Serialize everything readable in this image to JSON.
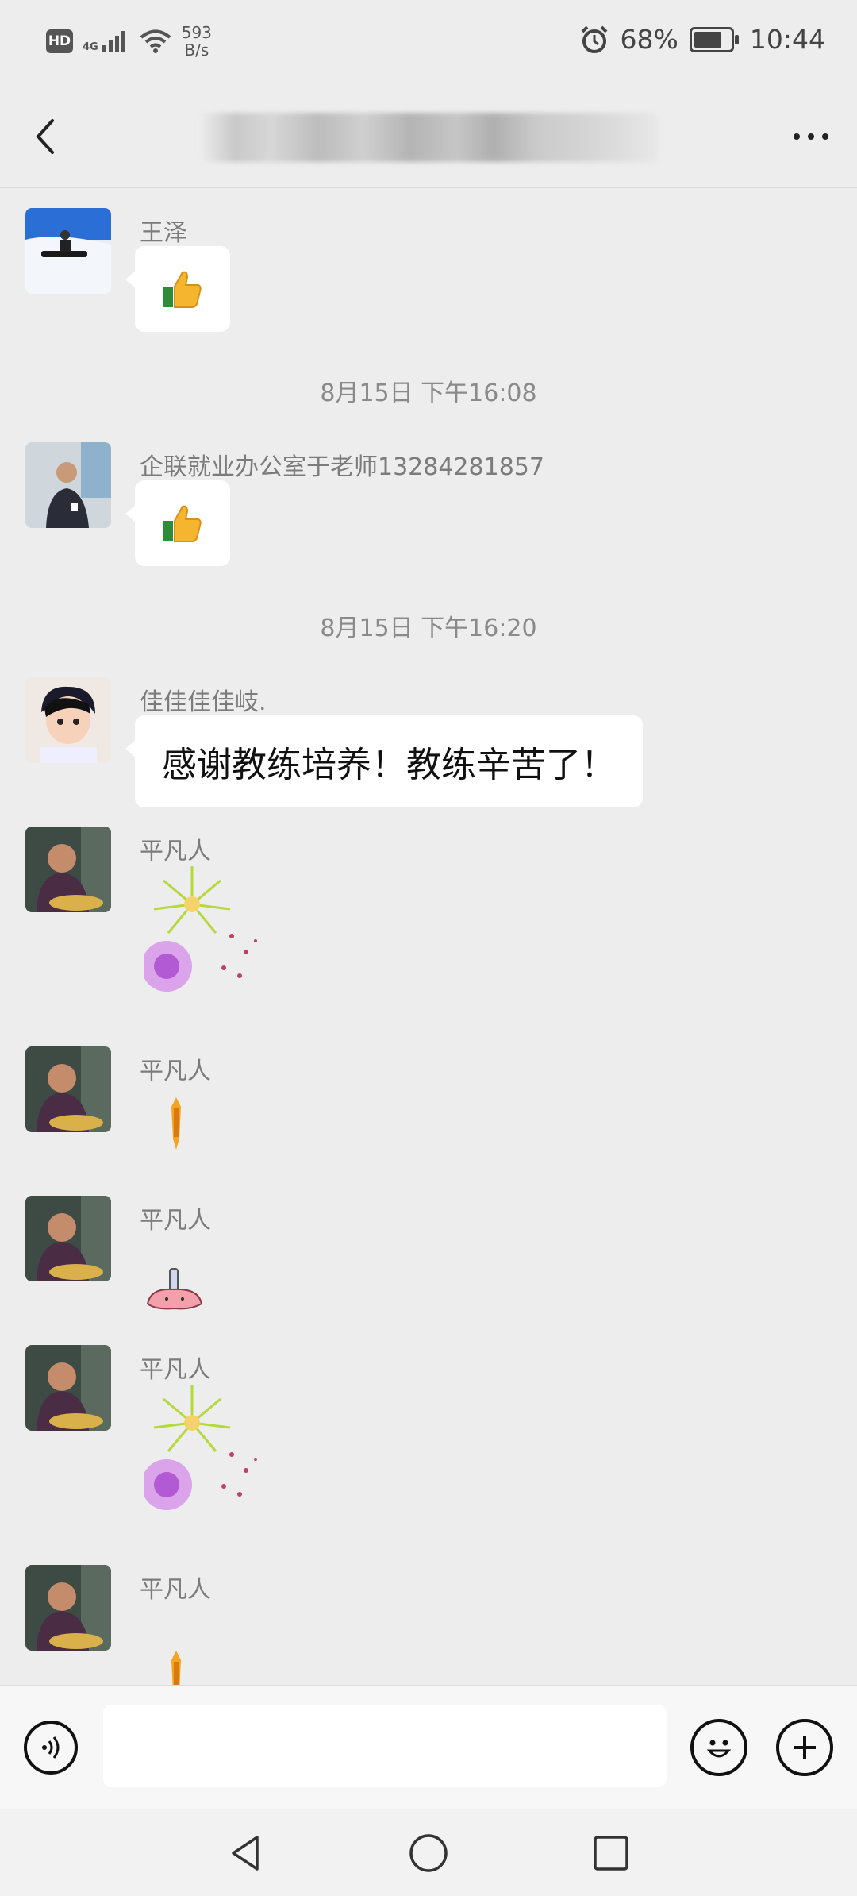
{
  "status_bar": {
    "hd": "HD",
    "network": "4G",
    "net_speed_value": "593",
    "net_speed_unit": "B/s",
    "battery": "68%",
    "battery_level": 0.68,
    "time": "10:44"
  },
  "header": {
    "back_icon": "chevron-left-icon",
    "more_icon": "more-dots-icon"
  },
  "messages": [
    {
      "sender": "王泽",
      "type": "emoji",
      "emoji": "👍"
    },
    {
      "timestamp": "8月15日 下午16:08"
    },
    {
      "sender": "企联就业办公室于老师13284281857",
      "type": "emoji",
      "emoji": "👍"
    },
    {
      "timestamp": "8月15日 下午16:20"
    },
    {
      "sender": "佳佳佳佳岐.",
      "type": "text",
      "text": "感谢教练培养！教练辛苦了！"
    },
    {
      "sender": "平凡人",
      "type": "sticker",
      "sticker": "fireworks"
    },
    {
      "sender": "平凡人",
      "type": "sticker",
      "sticker": "firework-rocket"
    },
    {
      "sender": "平凡人",
      "type": "sticker",
      "sticker": "firecracker-creature"
    },
    {
      "sender": "平凡人",
      "type": "sticker",
      "sticker": "fireworks"
    },
    {
      "sender": "平凡人",
      "type": "sticker",
      "sticker": "firework-rocket"
    }
  ],
  "input_bar": {
    "voice_icon": "voice-icon",
    "emoji_icon": "emoji-icon",
    "plus_icon": "plus-icon",
    "input_value": ""
  },
  "system_nav": {
    "back": "triangle-back-icon",
    "home": "circle-home-icon",
    "recents": "square-recents-icon"
  }
}
